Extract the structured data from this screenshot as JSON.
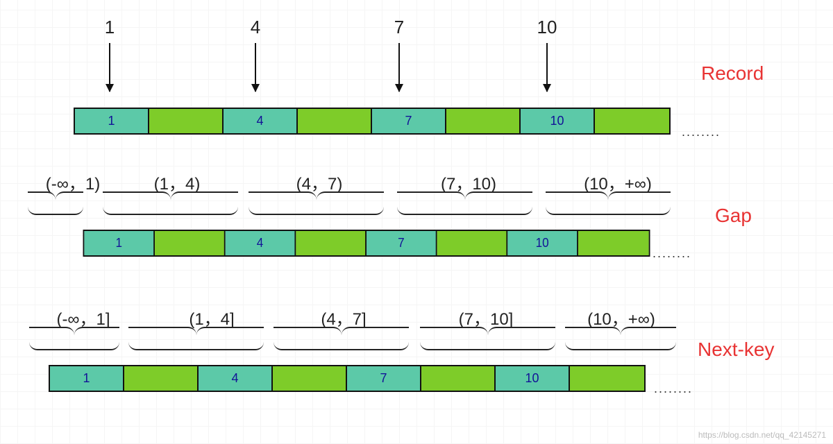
{
  "labels": {
    "record": "Record",
    "gap": "Gap",
    "nextkey": "Next-key",
    "ellipsis": "........"
  },
  "record": {
    "indices": [
      "1",
      "4",
      "7",
      "10"
    ],
    "cells": [
      "1",
      "4",
      "7",
      "10"
    ]
  },
  "gap": {
    "intervals": [
      "(-∞，1)",
      "(1，4)",
      "(4，7)",
      "(7，10)",
      "(10，+∞)"
    ],
    "cells": [
      "1",
      "4",
      "7",
      "10"
    ]
  },
  "nextkey": {
    "intervals": [
      "(-∞，1]",
      "(1，4]",
      "(4，7]",
      "(7，10]",
      "(10，+∞)"
    ],
    "cells": [
      "1",
      "4",
      "7",
      "10"
    ]
  },
  "watermark": "https://blog.csdn.net/qq_42145271",
  "chart_data": {
    "type": "table",
    "title": "MySQL lock types illustration",
    "rows": [
      {
        "name": "Record",
        "lock_points": [
          1,
          4,
          7,
          10
        ]
      },
      {
        "name": "Gap",
        "intervals": [
          "(-∞,1)",
          "(1,4)",
          "(4,7)",
          "(7,10)",
          "(10,+∞)"
        ],
        "records": [
          1,
          4,
          7,
          10
        ]
      },
      {
        "name": "Next-key",
        "intervals": [
          "(-∞,1]",
          "(1,4]",
          "(4,7]",
          "(7,10]",
          "(10,+∞)"
        ],
        "records": [
          1,
          4,
          7,
          10
        ]
      }
    ],
    "colors": {
      "record_cell": "#5cc9a8",
      "gap_cell": "#7ecc29",
      "label": "#e83333",
      "value_text": "#121297"
    }
  }
}
